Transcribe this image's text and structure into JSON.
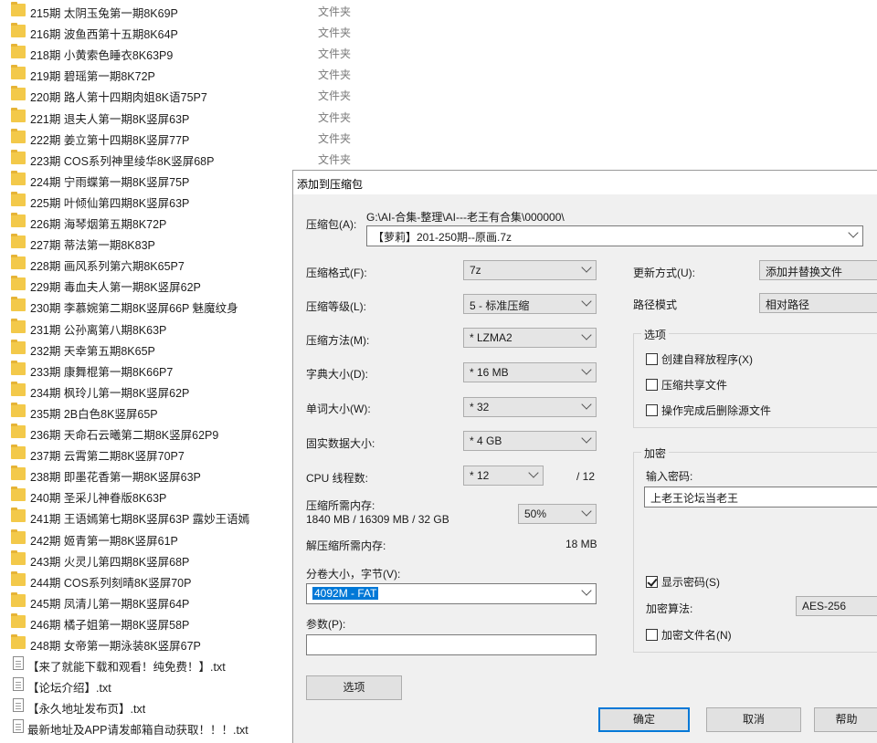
{
  "explorer": {
    "folder_type": "文件夹",
    "folders": [
      "215期  太阴玉兔第一期8K69P",
      "216期  波鱼西第十五期8K64P",
      "218期  小黄索色睡衣8K63P9",
      "219期  碧瑶第一期8K72P",
      "220期  路人第十四期肉姐8K语75P7",
      "221期  退夫人第一期8K竖屏63P",
      "222期  姜立第十四期8K竖屏77P",
      "223期  COS系列神里绫华8K竖屏68P",
      "224期  宁雨蝶第一期8K竖屏75P",
      "225期  叶倾仙第四期8K竖屏63P",
      "226期  海琴烟第五期8K72P",
      "227期  蒂法第一期8K83P",
      "228期  画风系列第六期8K65P7",
      "229期  毒血夫人第一期8K竖屏62P",
      "230期  李慕婉第二期8K竖屏66P 魅魔纹身",
      "231期  公孙离第八期8K63P",
      "232期  天幸第五期8K65P",
      "233期  康舞棍第一期8K66P7",
      "234期  枫玲儿第一期8K竖屏62P",
      "235期  2B白色8K竖屏65P",
      "236期  天命石云曦第二期8K竖屏62P9",
      "237期  云霄第二期8K竖屏70P7",
      "238期  即墨花香第一期8K竖屏63P",
      "240期  圣采儿神眷版8K63P",
      "241期  王语嫣第七期8K竖屏63P  露妙王语嫣",
      "242期  姬青第一期8K竖屏61P",
      "243期  火灵儿第四期8K竖屏68P",
      "244期  COS系列刻晴8K竖屏70P",
      "245期  凤清儿第一期8K竖屏64P",
      "246期  橘子姐第一期8K竖屏58P",
      "248期  女帝第一期泳装8K竖屏67P"
    ],
    "files": [
      "【来了就能下载和观看！纯免费！】.txt",
      "【论坛介绍】.txt",
      "【永久地址发布页】.txt",
      "最新地址及APP请发邮箱自动获取！！！.txt"
    ]
  },
  "dialog": {
    "title": "添加到压缩包",
    "archive_label": "压缩包(A):",
    "archive_path": "G:\\AI-合集-整理\\AI---老王有合集\\000000\\",
    "archive_name": "【萝莉】201-250期--原画.7z",
    "format_label": "压缩格式(F):",
    "format_value": "7z",
    "level_label": "压缩等级(L):",
    "level_value": "5 - 标准压缩",
    "method_label": "压缩方法(M):",
    "method_value": "* LZMA2",
    "dict_label": "字典大小(D):",
    "dict_value": "* 16 MB",
    "word_label": "单词大小(W):",
    "word_value": "* 32",
    "solid_label": "固实数据大小:",
    "solid_value": "* 4 GB",
    "threads_label": "CPU 线程数:",
    "threads_value": "* 12",
    "threads_total": "/ 12",
    "mem_comp_label": "压缩所需内存:",
    "mem_comp_value": "1840 MB / 16309 MB / 32 GB",
    "mem_percent": "50%",
    "mem_decomp_label": "解压缩所需内存:",
    "mem_decomp_value": "18 MB",
    "split_label": "分卷大小，字节(V):",
    "split_value": "4092M - FAT",
    "params_label": "参数(P):",
    "params_value": "",
    "options_button": "选项",
    "update_label": "更新方式(U):",
    "update_value": "添加并替换文件",
    "path_label": "路径模式",
    "path_value": "相对路径",
    "options_group": "选项",
    "opt_sfx": "创建自释放程序(X)",
    "opt_shared": "压缩共享文件",
    "opt_delete": "操作完成后删除源文件",
    "encrypt_group": "加密",
    "password_label": "输入密码:",
    "password_value": "上老王论坛当老王",
    "show_password": "显示密码(S)",
    "enc_method_label": "加密算法:",
    "enc_method_value": "AES-256",
    "encrypt_names": "加密文件名(N)",
    "ok_button": "确定",
    "cancel_button": "取消",
    "help_button": "帮助"
  }
}
